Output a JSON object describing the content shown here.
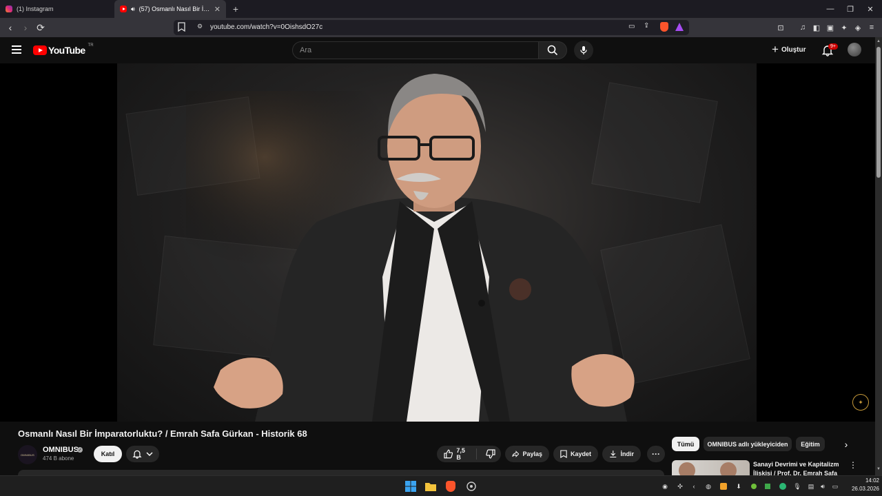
{
  "browser": {
    "tabs": [
      {
        "label": "(1) Instagram",
        "icon": "instagram-icon",
        "active": false
      },
      {
        "label": "(57) Osmanlı Nasıl Bir İmparatorluktu? / Emrah Safa Gürkan - Historik 68",
        "icon": "youtube-icon",
        "active": true
      }
    ],
    "url": "youtube.com/watch?v=0OishsdO27c"
  },
  "youtube": {
    "logo_word": "YouTube",
    "country_code": "TR",
    "search_placeholder": "Ara",
    "create_label": "Oluştur",
    "notification_count": "9+"
  },
  "video": {
    "title": "Osmanlı Nasıl Bir İmparatorluktu? / Emrah Safa Gürkan - Historik 68",
    "channel_name": "OMNIBUS",
    "channel_avatar_text": "OMNIBUS",
    "subscribers": "474 B abone",
    "join_label": "Katıl",
    "likes": "7,5 B",
    "share_label": "Paylaş",
    "save_label": "Kaydet",
    "download_label": "İndir",
    "more_label": "···"
  },
  "sidebar": {
    "chips": [
      "Tümü",
      "OMNIBUS adlı yükleyiciden",
      "Eğitim"
    ],
    "recommended": {
      "title": "Sanayi Devrimi ve Kapitalizm İlişkisi / Prof. Dr. Emrah Safa Gürkan"
    }
  },
  "taskbar": {
    "time": "14:02",
    "date": "26.03.2026"
  },
  "colors": {
    "brand_red": "#ff0000",
    "background": "#0f0f0f",
    "pill": "#272727",
    "explore_accent": "#c79a3a"
  }
}
